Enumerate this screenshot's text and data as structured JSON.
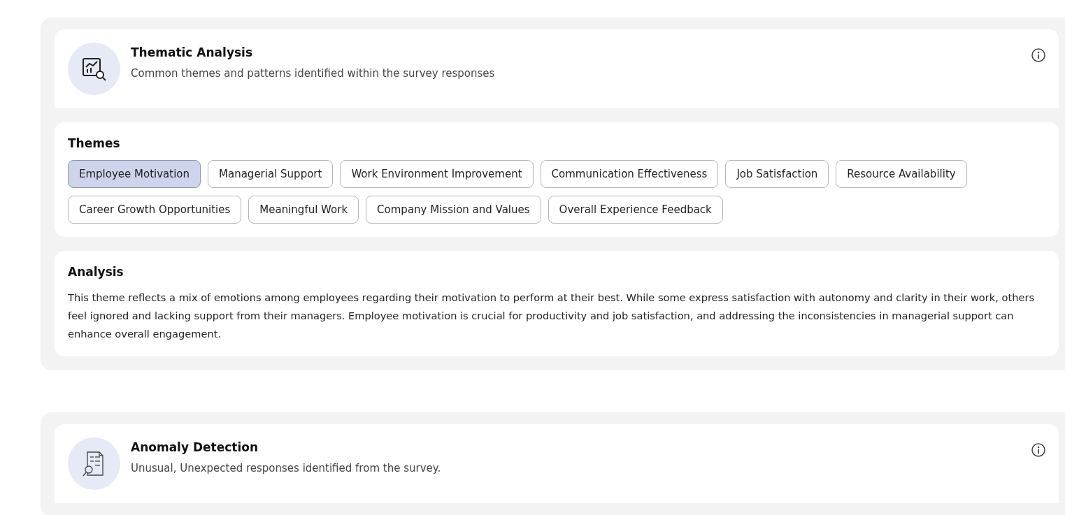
{
  "sections": [
    {
      "kind": "thematic",
      "title": "Thematic Analysis",
      "subtitle": "Common themes and patterns identified within the survey responses",
      "themes_heading": "Themes",
      "themes": [
        {
          "label": "Employee Motivation",
          "selected": true
        },
        {
          "label": "Managerial Support",
          "selected": false
        },
        {
          "label": "Work Environment Improvement",
          "selected": false
        },
        {
          "label": "Communication Effectiveness",
          "selected": false
        },
        {
          "label": "Job Satisfaction",
          "selected": false
        },
        {
          "label": "Resource Availability",
          "selected": false
        },
        {
          "label": "Career Growth Opportunities",
          "selected": false
        },
        {
          "label": "Meaningful Work",
          "selected": false
        },
        {
          "label": "Company Mission and Values",
          "selected": false
        },
        {
          "label": "Overall Experience Feedback",
          "selected": false
        }
      ],
      "analysis_heading": "Analysis",
      "analysis_text": "This theme reflects a mix of emotions among employees regarding their motivation to perform at their best. While some express satisfaction with autonomy and clarity in their work, others feel ignored and lacking support from their managers. Employee motivation is crucial for productivity and job satisfaction, and addressing the inconsistencies in managerial support can enhance overall engagement."
    },
    {
      "kind": "anomaly",
      "title": "Anomaly Detection",
      "subtitle": "Unusual, Unexpected responses identified from the survey."
    }
  ]
}
